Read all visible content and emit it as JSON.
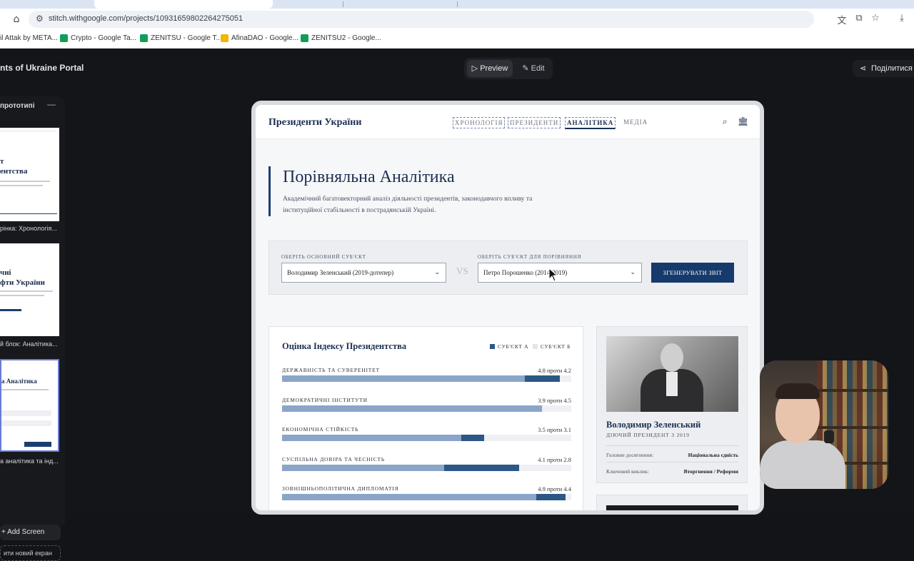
{
  "browser": {
    "url": "stitch.withgoogle.com/projects/10931659802264275051",
    "bookmarks": [
      {
        "label": "il Attak by META...",
        "color": "#5f6368"
      },
      {
        "label": "Crypto - Google Ta...",
        "color": "#0f9d58"
      },
      {
        "label": "ZENITSU - Google T...",
        "color": "#0f9d58"
      },
      {
        "label": "AfinaDAO - Google...",
        "color": "#f4b400"
      },
      {
        "label": "ZENITSU2 - Google...",
        "color": "#0f9d58"
      }
    ]
  },
  "app": {
    "project_title": "nts of Ukraine Portal",
    "mode_preview": "Preview",
    "mode_edit": "Edit",
    "share": "Поділитися",
    "left_panel": {
      "heading": "прототипі",
      "screens": [
        {
          "thumb_title": "т\nентства",
          "label": "рінка: Хронологія..."
        },
        {
          "thumb_title": "чні\nфти України",
          "label": "й блок: Аналітика..."
        },
        {
          "thumb_title": "а Аналітика",
          "label": "а аналітика та інд..."
        }
      ],
      "add_screen": "Add Screen",
      "new_screen": "ити новий екран"
    }
  },
  "site": {
    "logo": "Президенти України",
    "nav": [
      "ХРОНОЛОГІЯ",
      "ПРЕЗИДЕНТИ",
      "АНАЛІТИКА",
      "МЕДІА"
    ],
    "icons": {
      "search": "search-icon",
      "institution": "bank-icon"
    },
    "hero": {
      "title": "Порівняльна Аналітика",
      "subtitle": "Академічний багатовекторний аналіз діяльності президентів, законодавчого впливу та інституційної стабільності в пострадянській Україні."
    },
    "compare": {
      "primary_label": "ОБЕРІТЬ ОСНОВНИЙ СУБ'ЄКТ",
      "primary_value": "Володимир Зеленський (2019-дотепер)",
      "vs": "VS",
      "secondary_label": "ОБЕРІТЬ СУБ'ЄКТ ДЛЯ ПОРІВНЯННЯ",
      "secondary_value": "Петро Порошенко (2014-2019)",
      "generate": "ЗГЕНЕРУВАТИ ЗВІТ"
    },
    "index": {
      "title": "Оцінка Індексу Президентства",
      "legend_a": "СУБ'ЄКТ А",
      "legend_b": "СУБ'ЄКТ Б",
      "color_a": "#2c5786",
      "color_b": "#e1e6ef",
      "metrics": [
        {
          "name": "ДЕРЖАВНІСТЬ ТА СУВЕРЕНІТЕТ",
          "label": "4.8 проти 4.2",
          "a": 4.8,
          "b": 4.2
        },
        {
          "name": "ДЕМОКРАТИЧНІ ІНСТИТУТИ",
          "label": "3.9 проти 4.5",
          "a": 3.9,
          "b": 4.5
        },
        {
          "name": "ЕКОНОМІЧНА СТІЙКІСТЬ",
          "label": "3.5 проти 3.1",
          "a": 3.5,
          "b": 3.1
        },
        {
          "name": "СУСПІЛЬНА ДОВІРА ТА ЧЕСНІСТЬ",
          "label": "4.1 проти 2.8",
          "a": 4.1,
          "b": 2.8
        },
        {
          "name": "ЗОВНІШНЬОПОЛІТИЧНА ДИПЛОМАТІЯ",
          "label": "4.9 проти 4.4",
          "a": 4.9,
          "b": 4.4
        }
      ],
      "max": 5
    },
    "profile": {
      "name": "Володимир Зеленський",
      "role": "ДІЮЧИЙ ПРЕЗИДЕНТ З 2019",
      "rows": [
        {
          "key": "Головне досягнення:",
          "value": "Національна єдність"
        },
        {
          "key": "Ключовий виклик:",
          "value": "Вторгнення / Реформи"
        }
      ]
    }
  }
}
